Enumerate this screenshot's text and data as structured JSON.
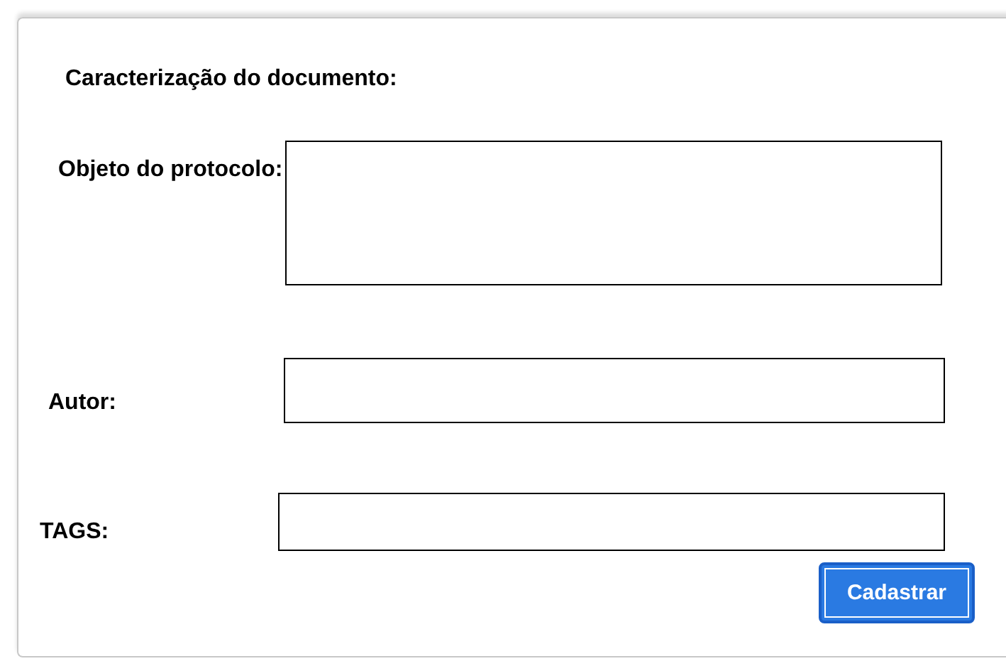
{
  "title": "Caracterização do documento:",
  "fields": [
    {
      "label": "Objeto do protocolo:",
      "kind": "multiline"
    },
    {
      "label": "Autor:",
      "kind": "line"
    },
    {
      "label": "TAGS:",
      "kind": "line"
    }
  ],
  "button": "Cadastrar"
}
